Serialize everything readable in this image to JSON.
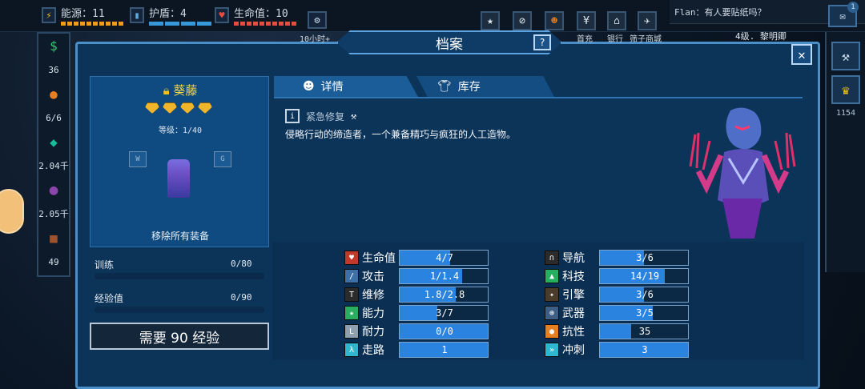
{
  "topbar": {
    "energy_label": "能源：11",
    "shield_label": "护盾：4",
    "hull_label": "生命值：10",
    "timer_label": "10小时+",
    "buttons": [
      "首充",
      "银行",
      "筛子商城"
    ],
    "rank": "4级. 黎明卿"
  },
  "chat": {
    "message": "Flan：有人要贴纸吗？",
    "badge": "1"
  },
  "left_column": [
    "36",
    "6/6",
    "2.04千",
    "2.05千",
    "49"
  ],
  "right_column": {
    "value": "1154"
  },
  "panel": {
    "title": "档案",
    "help": "?",
    "close": "✕"
  },
  "character": {
    "name": "葵藤",
    "level": "等级：1/40",
    "unequip": "移除所有装备",
    "stars": 4
  },
  "progress": {
    "training_label": "训练",
    "training_value": "0/80",
    "xp_label": "经验值",
    "xp_value": "0/90",
    "need_button": "需要 90 经验"
  },
  "tabs": {
    "details": "详情",
    "inventory": "库存"
  },
  "skill": {
    "name": "紧急修复",
    "description": "侵略行动的缔造者，一个兼备精巧与疯狂的人工造物。"
  },
  "stats_left": [
    {
      "label": "生命值",
      "value": "4/7",
      "fill": 0.57,
      "icon": "heart-icon",
      "color": "#c0392b"
    },
    {
      "label": "攻击",
      "value": "1/1.4",
      "fill": 0.71,
      "icon": "sword-icon",
      "color": "#3d6fa8"
    },
    {
      "label": "维修",
      "value": "1.8/2.8",
      "fill": 0.64,
      "icon": "hammer-icon",
      "color": "#2b2b2b"
    },
    {
      "label": "能力",
      "value": "3/7",
      "fill": 0.43,
      "icon": "ability-icon",
      "color": "#27ae60"
    },
    {
      "label": "耐力",
      "value": "0/0",
      "fill": 1.0,
      "icon": "boot-icon",
      "color": "#8e9fb0"
    },
    {
      "label": "走路",
      "value": "1",
      "fill": 1.0,
      "icon": "walk-icon",
      "color": "#2fb7d0"
    }
  ],
  "stats_right": [
    {
      "label": "导航",
      "value": "3/6",
      "fill": 0.5,
      "icon": "navigation-icon",
      "color": "#2b2b2b"
    },
    {
      "label": "科技",
      "value": "14/19",
      "fill": 0.74,
      "icon": "flask-icon",
      "color": "#27ae60"
    },
    {
      "label": "引擎",
      "value": "3/6",
      "fill": 0.5,
      "icon": "engine-icon",
      "color": "#4a3b2a"
    },
    {
      "label": "武器",
      "value": "3/5",
      "fill": 0.6,
      "icon": "crosshair-icon",
      "color": "#3d5f86"
    },
    {
      "label": "抗性",
      "value": "35",
      "fill": 0.35,
      "icon": "fire-icon",
      "color": "#e67e22"
    },
    {
      "label": "冲刺",
      "value": "3",
      "fill": 1.0,
      "icon": "sprint-icon",
      "color": "#2fb7d0"
    }
  ]
}
